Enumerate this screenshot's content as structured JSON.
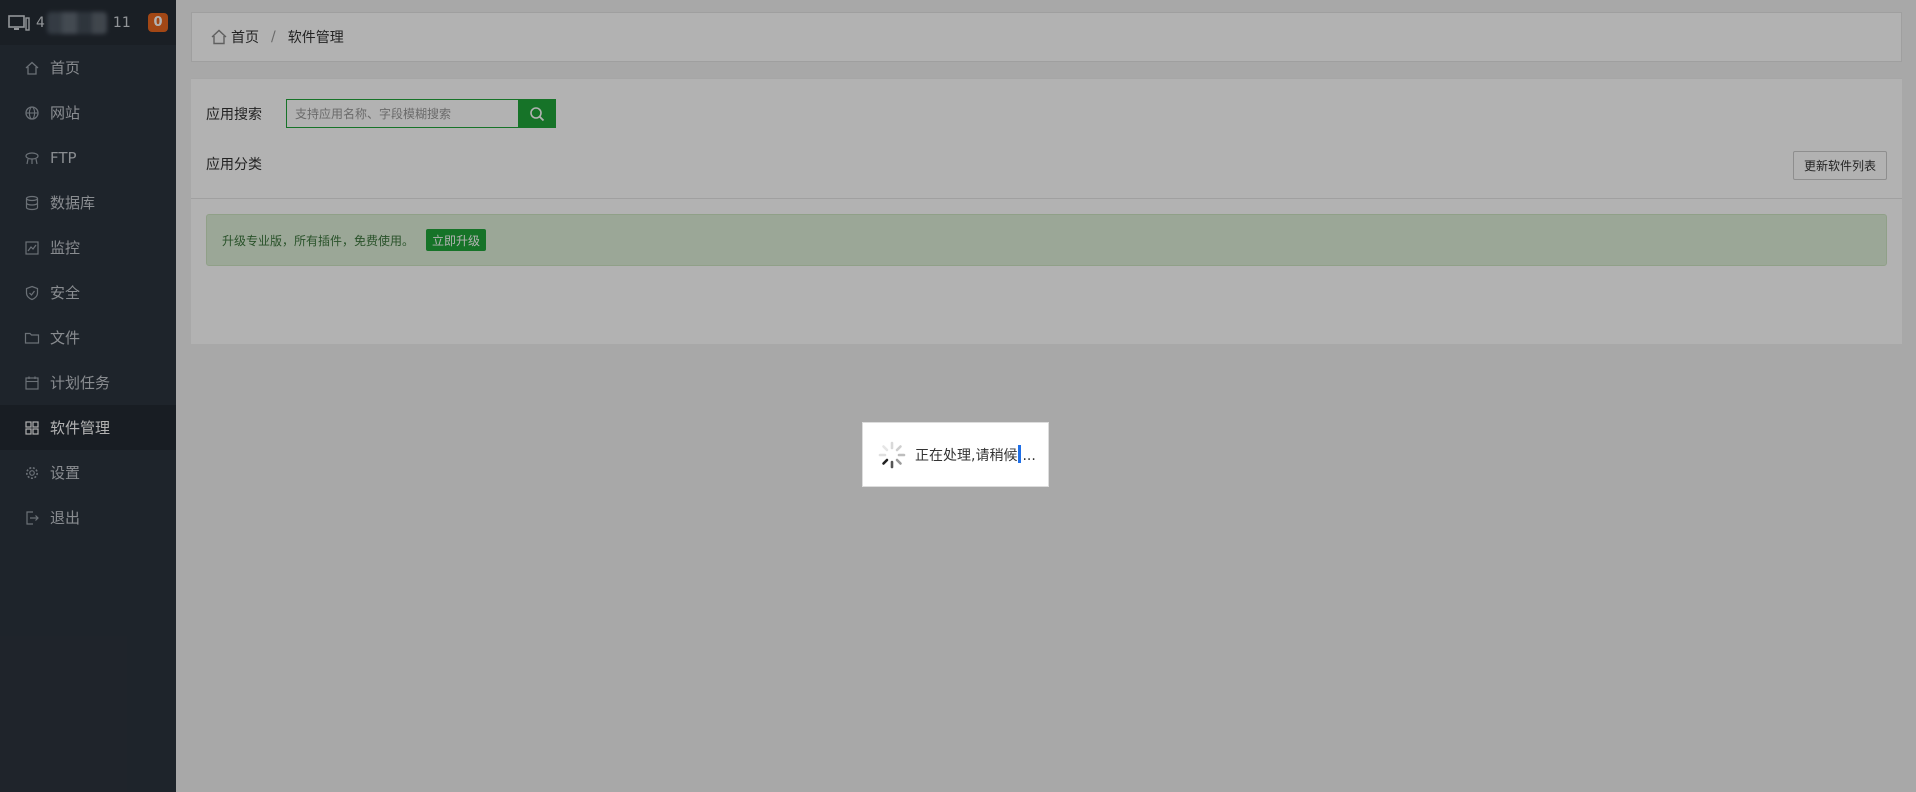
{
  "header": {
    "server_id_prefix": "4",
    "server_id_suffix": "11",
    "badge": "0"
  },
  "sidebar": {
    "items": [
      {
        "label": "首页",
        "icon": "home-icon"
      },
      {
        "label": "网站",
        "icon": "globe-icon"
      },
      {
        "label": "FTP",
        "icon": "ftp-icon"
      },
      {
        "label": "数据库",
        "icon": "database-icon"
      },
      {
        "label": "监控",
        "icon": "monitor-icon"
      },
      {
        "label": "安全",
        "icon": "shield-icon"
      },
      {
        "label": "文件",
        "icon": "folder-icon"
      },
      {
        "label": "计划任务",
        "icon": "calendar-icon"
      },
      {
        "label": "软件管理",
        "icon": "grid-icon",
        "active": true
      },
      {
        "label": "设置",
        "icon": "gear-icon"
      },
      {
        "label": "退出",
        "icon": "logout-icon"
      }
    ]
  },
  "breadcrumb": {
    "home": "首页",
    "current": "软件管理"
  },
  "search": {
    "label": "应用搜索",
    "placeholder": "支持应用名称、字段模糊搜索"
  },
  "category": {
    "label": "应用分类"
  },
  "update_button": "更新软件列表",
  "alert": {
    "text": "升级专业版，所有插件，免费使用。",
    "button": "立即升级"
  },
  "loading": {
    "text_before": "正在处理,请稍候",
    "text_after": "..."
  },
  "colors": {
    "accent": "#20a53a",
    "sidebar_bg": "#2c343e",
    "badge": "#e9661f"
  }
}
